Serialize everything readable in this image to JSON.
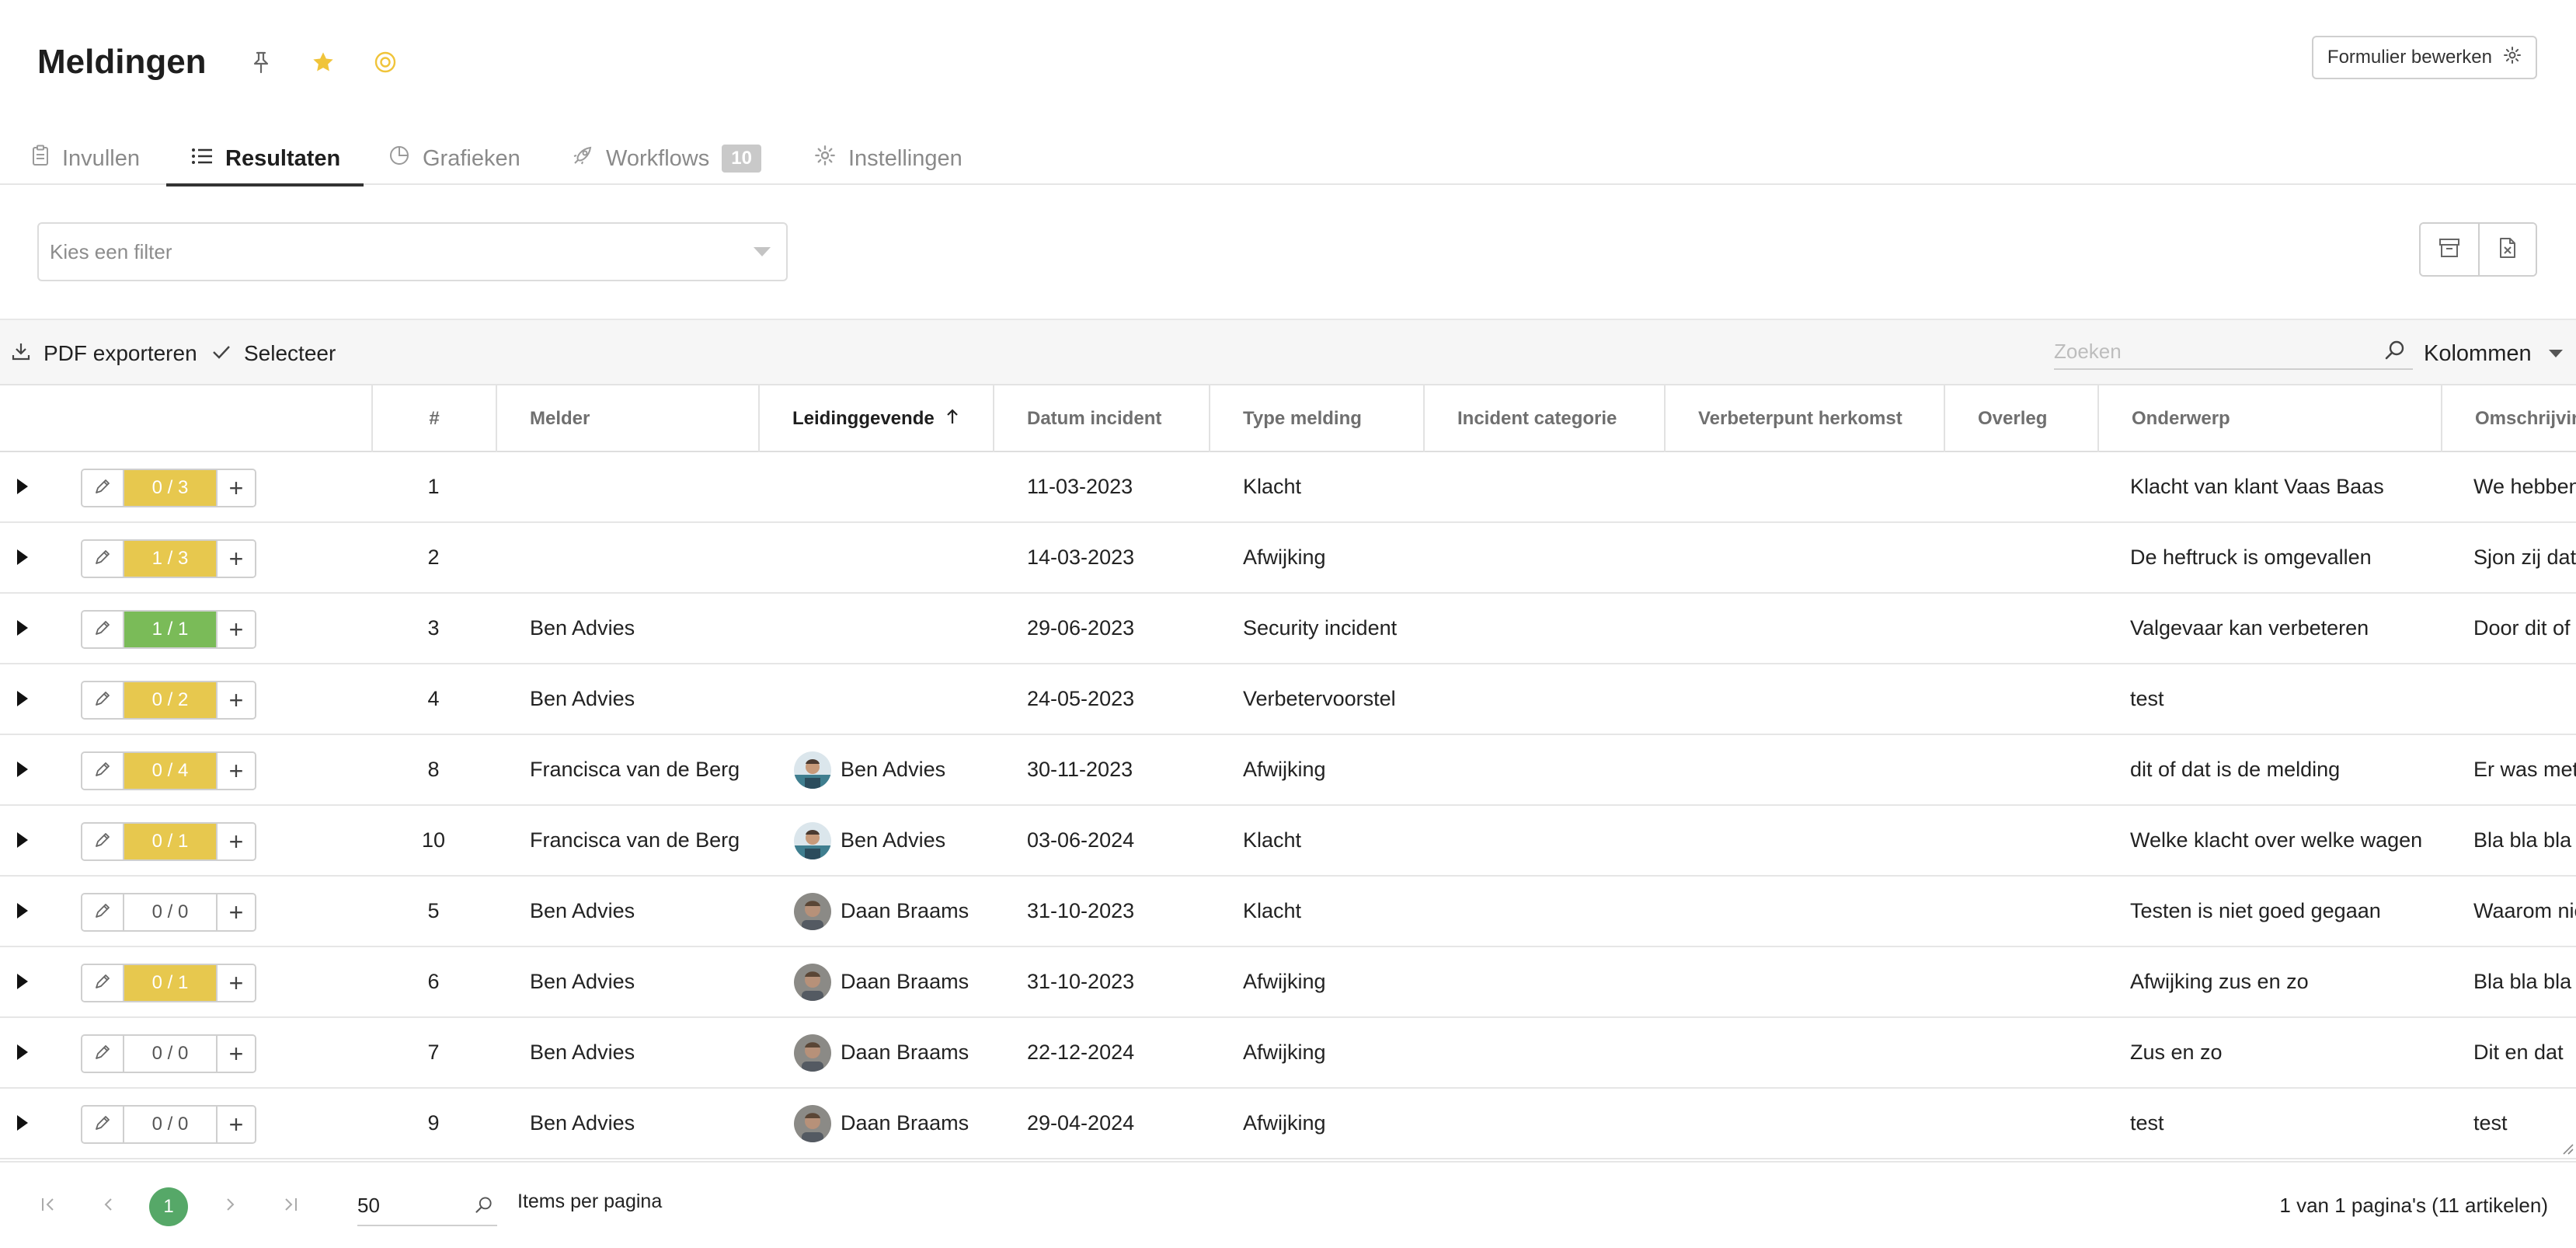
{
  "header": {
    "title": "Meldingen",
    "pin_icon": "pin-icon",
    "star_icon": "star-icon",
    "follow_icon": "target-icon",
    "edit_form_label": "Formulier bewerken",
    "edit_form_icon": "gear-icon"
  },
  "tabs": [
    {
      "label": "Invullen",
      "icon": "clipboard-icon",
      "active": false
    },
    {
      "label": "Resultaten",
      "icon": "list-icon",
      "active": true
    },
    {
      "label": "Grafieken",
      "icon": "pie-chart-icon",
      "active": false
    },
    {
      "label": "Workflows",
      "icon": "rocket-icon",
      "badge": "10",
      "active": false
    },
    {
      "label": "Instellingen",
      "icon": "gear-icon",
      "active": false
    }
  ],
  "filter": {
    "placeholder": "Kies een filter"
  },
  "toolbar": {
    "pdf_export_label": "PDF exporteren",
    "select_label": "Selecteer",
    "search_placeholder": "Zoeken",
    "columns_label": "Kolommen"
  },
  "table": {
    "columns": [
      "#",
      "Melder",
      "Leidinggevende",
      "Datum incident",
      "Type melding",
      "Incident categorie",
      "Verbeterpunt herkomst",
      "Overleg",
      "Onderwerp",
      "Omschrijving"
    ],
    "sorted_column": "Leidinggevende",
    "sort_direction": "ascending",
    "rows": [
      {
        "workflow": "0 / 3",
        "status": "yellow",
        "nr": "1",
        "melder": "",
        "leidinggevende": "",
        "avatar": "",
        "datum": "11-03-2023",
        "type": "Klacht",
        "onderwerp": "Klacht van klant Vaas Baas",
        "omschrijving": "We hebben"
      },
      {
        "workflow": "1 / 3",
        "status": "yellow",
        "nr": "2",
        "melder": "",
        "leidinggevende": "",
        "avatar": "",
        "datum": "14-03-2023",
        "type": "Afwijking",
        "onderwerp": "De heftruck is omgevallen",
        "omschrijving": "Sjon zij dat"
      },
      {
        "workflow": "1 / 1",
        "status": "green",
        "nr": "3",
        "melder": "Ben Advies",
        "leidinggevende": "",
        "avatar": "",
        "datum": "29-06-2023",
        "type": "Security incident",
        "onderwerp": "Valgevaar kan verbeteren",
        "omschrijving": "Door dit of d"
      },
      {
        "workflow": "0 / 2",
        "status": "yellow",
        "nr": "4",
        "melder": "Ben Advies",
        "leidinggevende": "",
        "avatar": "",
        "datum": "24-05-2023",
        "type": "Verbetervoorstel",
        "onderwerp": "test",
        "omschrijving": ""
      },
      {
        "workflow": "0 / 4",
        "status": "yellow",
        "nr": "8",
        "melder": "Francisca van de Berg",
        "leidinggevende": "Ben Advies",
        "avatar": "ben",
        "datum": "30-11-2023",
        "type": "Afwijking",
        "onderwerp": "dit of dat is de melding",
        "omschrijving": "Er was met"
      },
      {
        "workflow": "0 / 1",
        "status": "yellow",
        "nr": "10",
        "melder": "Francisca van de Berg",
        "leidinggevende": "Ben Advies",
        "avatar": "ben",
        "datum": "03-06-2024",
        "type": "Klacht",
        "onderwerp": "Welke klacht over welke wagen",
        "omschrijving": "Bla bla bla"
      },
      {
        "workflow": "0 / 0",
        "status": "none",
        "nr": "5",
        "melder": "Ben Advies",
        "leidinggevende": "Daan Braams",
        "avatar": "daan",
        "datum": "31-10-2023",
        "type": "Klacht",
        "onderwerp": "Testen is niet goed gegaan",
        "omschrijving": "Waarom nie"
      },
      {
        "workflow": "0 / 1",
        "status": "yellow",
        "nr": "6",
        "melder": "Ben Advies",
        "leidinggevende": "Daan Braams",
        "avatar": "daan",
        "datum": "31-10-2023",
        "type": "Afwijking",
        "onderwerp": "Afwijking zus en zo",
        "omschrijving": "Bla bla bla"
      },
      {
        "workflow": "0 / 0",
        "status": "none",
        "nr": "7",
        "melder": "Ben Advies",
        "leidinggevende": "Daan Braams",
        "avatar": "daan",
        "datum": "22-12-2024",
        "type": "Afwijking",
        "onderwerp": "Zus en zo",
        "omschrijving": "Dit en dat"
      },
      {
        "workflow": "0 / 0",
        "status": "none",
        "nr": "9",
        "melder": "Ben Advies",
        "leidinggevende": "Daan Braams",
        "avatar": "daan",
        "datum": "29-04-2024",
        "type": "Afwijking",
        "onderwerp": "test",
        "omschrijving": "test"
      }
    ]
  },
  "pagination": {
    "current_page": "1",
    "page_size": "50",
    "page_size_label": "Items per pagina",
    "summary": "1 van 1 pagina's (11 artikelen)"
  },
  "colors": {
    "status_yellow": "#e7c84e",
    "status_green": "#7abb58",
    "star": "#f0c43a",
    "pagination_active": "#56a868"
  }
}
